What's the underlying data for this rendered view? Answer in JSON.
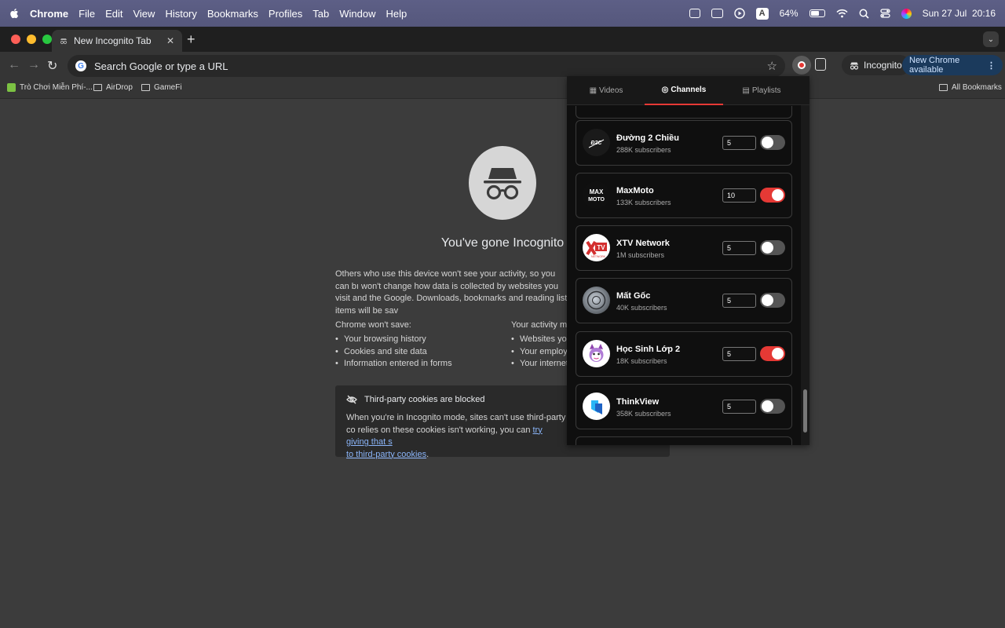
{
  "menubar": {
    "app": "Chrome",
    "items": [
      "File",
      "Edit",
      "View",
      "History",
      "Bookmarks",
      "Profiles",
      "Tab",
      "Window",
      "Help"
    ],
    "status": {
      "battery": "64%",
      "datetime": "Sun 27 Jul  20:16",
      "input_source": "A"
    }
  },
  "tabs": [
    {
      "title": "New Incognito Tab"
    }
  ],
  "toolbar": {
    "omnibox_placeholder": "Search Google or type a URL",
    "incognito_label": "Incognito",
    "update_label": "New Chrome available"
  },
  "bookmarks": {
    "items": [
      {
        "label": "Trò Chơi Miễn Phí-...",
        "icon": "game-icon"
      },
      {
        "label": "AirDrop",
        "icon": "folder-icon"
      },
      {
        "label": "GameFi",
        "icon": "folder-icon"
      }
    ],
    "all_bookmarks": "All Bookmarks"
  },
  "incognito": {
    "title": "You've gone Incognito",
    "paragraph": "Others who use this device won't see your activity, so you can bı won't change how data is collected by websites you visit and the Google. Downloads, bookmarks and reading list items will be sav",
    "wont_save_heading": "Chrome won't save:",
    "wont_save": [
      "Your browsing history",
      "Cookies and site data",
      "Information entered in forms"
    ],
    "might_heading": "Your activity mi",
    "might": [
      "Websites you",
      "Your employe",
      "Your internet"
    ],
    "cookies_title": "Third-party cookies are blocked",
    "cookies_text": "When you're in Incognito mode, sites can't use third-party co relies on these cookies isn't working, you can ",
    "cookies_link1": "try giving that s",
    "cookies_link2": "to third-party cookies",
    "cookies_end": "."
  },
  "popup": {
    "tabs": [
      {
        "label": "Videos",
        "icon": "video-icon",
        "active": false
      },
      {
        "label": "Channels",
        "icon": "channel-icon",
        "active": true
      },
      {
        "label": "Playlists",
        "icon": "playlist-icon",
        "active": false
      }
    ],
    "channels": [
      {
        "name": "Đường 2 Chiều",
        "subscribers": "288K subscribers",
        "count": "5",
        "enabled": false,
        "avatar_color": "#1a1a1a"
      },
      {
        "name": "MaxMoto",
        "subscribers": "133K subscribers",
        "count": "10",
        "enabled": true,
        "avatar_color": "#101010"
      },
      {
        "name": "XTV Network",
        "subscribers": "1M subscribers",
        "count": "5",
        "enabled": false,
        "avatar_color": "#ffffff"
      },
      {
        "name": "Mất Gốc",
        "subscribers": "40K subscribers",
        "count": "5",
        "enabled": false,
        "avatar_color": "#8a8a8a"
      },
      {
        "name": "Học Sinh Lớp 2",
        "subscribers": "18K subscribers",
        "count": "5",
        "enabled": true,
        "avatar_color": "#ffffff"
      },
      {
        "name": "ThinkView",
        "subscribers": "358K subscribers",
        "count": "5",
        "enabled": false,
        "avatar_color": "#ffffff"
      }
    ]
  },
  "colors": {
    "accent_red": "#e53935",
    "menubar": "#5d5f86",
    "link": "#8ab4f8"
  }
}
